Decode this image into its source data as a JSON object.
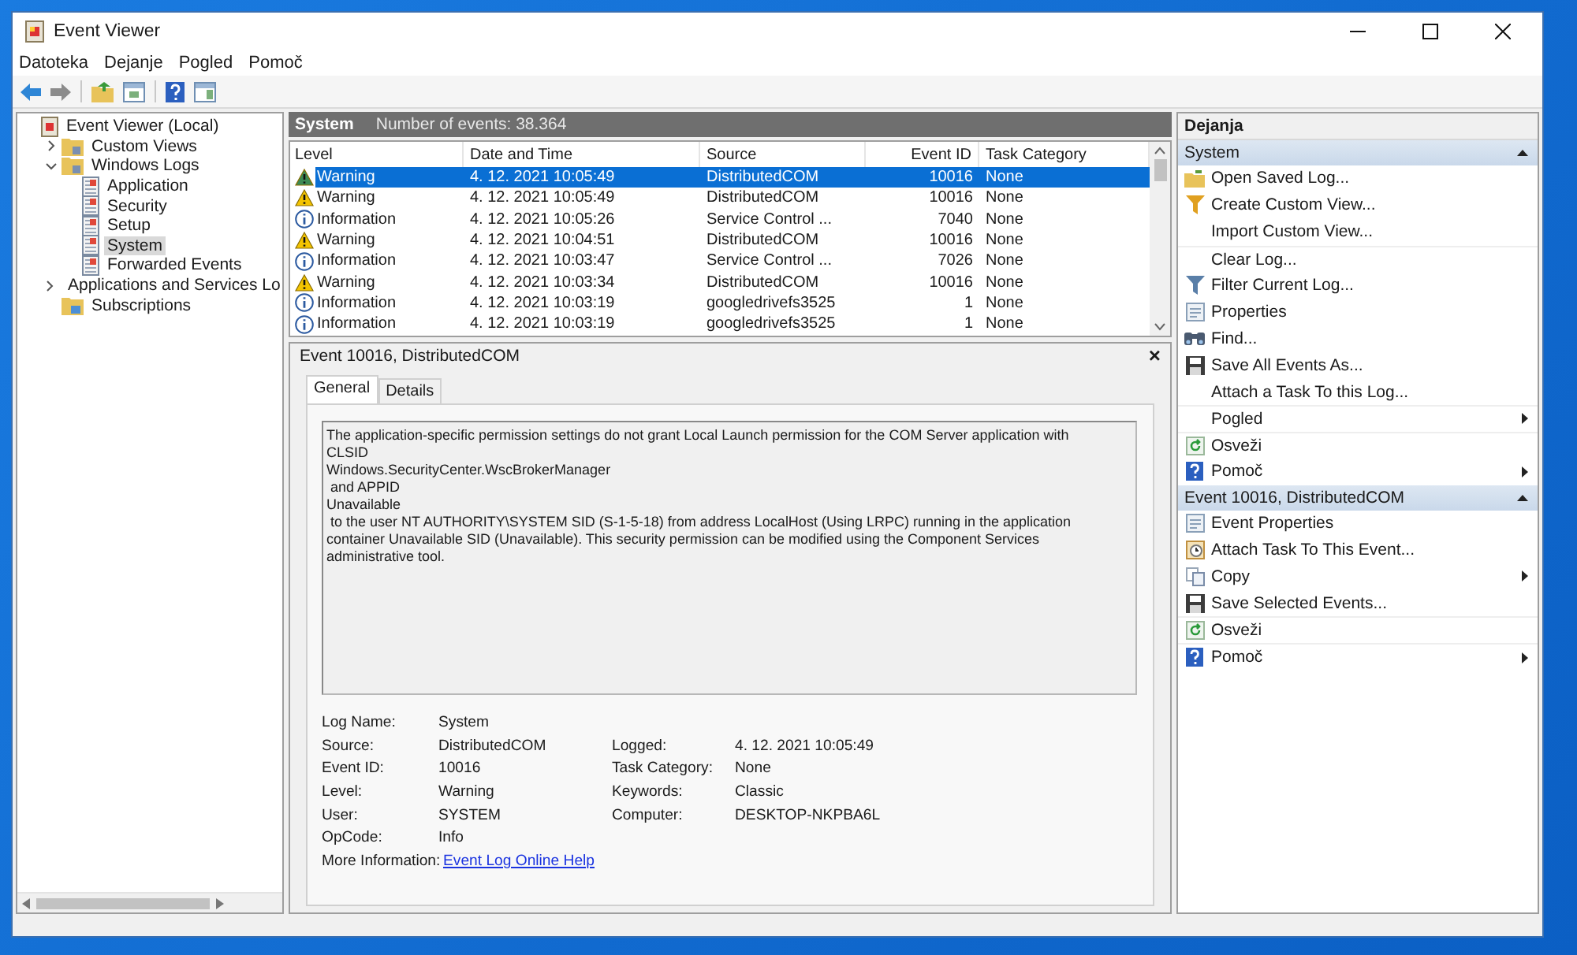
{
  "window": {
    "title": "Event Viewer"
  },
  "menu": [
    "Datoteka",
    "Dejanje",
    "Pogled",
    "Pomoč"
  ],
  "tree": [
    {
      "label": "Event Viewer (Local)",
      "selected": false,
      "children": [
        {
          "label": "Custom Views",
          "expanded": false,
          "selected": false
        },
        {
          "label": "Windows Logs",
          "expanded": true,
          "selected": false,
          "children": [
            {
              "label": "Application",
              "selected": false
            },
            {
              "label": "Security",
              "selected": false
            },
            {
              "label": "Setup",
              "selected": false
            },
            {
              "label": "System",
              "selected": true
            },
            {
              "label": "Forwarded Events",
              "selected": false
            }
          ]
        },
        {
          "label": "Applications and Services Lo",
          "expanded": false,
          "selected": false
        },
        {
          "label": "Subscriptions",
          "selected": false
        }
      ]
    }
  ],
  "log": {
    "name": "System",
    "event_count": "Number of events: 38.364",
    "table": {
      "columns": [
        "Level",
        "Date and Time",
        "Source",
        "Event ID",
        "Task Category"
      ],
      "rows": [
        {
          "kind": "warning",
          "level": "Warning",
          "date": "4. 12. 2021 10:05:49",
          "source": "DistributedCOM",
          "event_id": "10016",
          "task_category": "None",
          "selected": true
        },
        {
          "kind": "warning",
          "level": "Warning",
          "date": "4. 12. 2021 10:05:49",
          "source": "DistributedCOM",
          "event_id": "10016",
          "task_category": "None",
          "selected": false
        },
        {
          "kind": "information",
          "level": "Information",
          "date": "4. 12. 2021 10:05:26",
          "source": "Service Control ...",
          "event_id": "7040",
          "task_category": "None",
          "selected": false
        },
        {
          "kind": "warning",
          "level": "Warning",
          "date": "4. 12. 2021 10:04:51",
          "source": "DistributedCOM",
          "event_id": "10016",
          "task_category": "None",
          "selected": false
        },
        {
          "kind": "information",
          "level": "Information",
          "date": "4. 12. 2021 10:03:47",
          "source": "Service Control ...",
          "event_id": "7026",
          "task_category": "None",
          "selected": false
        },
        {
          "kind": "warning",
          "level": "Warning",
          "date": "4. 12. 2021 10:03:34",
          "source": "DistributedCOM",
          "event_id": "10016",
          "task_category": "None",
          "selected": false
        },
        {
          "kind": "information",
          "level": "Information",
          "date": "4. 12. 2021 10:03:19",
          "source": "googledrivefs3525",
          "event_id": "1",
          "task_category": "None",
          "selected": false
        },
        {
          "kind": "information",
          "level": "Information",
          "date": "4. 12. 2021 10:03:19",
          "source": "googledrivefs3525",
          "event_id": "1",
          "task_category": "None",
          "selected": false
        }
      ]
    }
  },
  "detail": {
    "title": "Event 10016, DistributedCOM",
    "close": "×",
    "tabs": [
      {
        "label": "General",
        "selected": true
      },
      {
        "label": "Details",
        "selected": false
      }
    ],
    "message": [
      "The application-specific permission settings do not grant Local Launch permission for the COM Server application with",
      "CLSID",
      "Windows.SecurityCenter.WscBrokerManager",
      " and APPID",
      "Unavailable",
      " to the user NT AUTHORITY\\SYSTEM SID (S-1-5-18) from address LocalHost (Using LRPC) running in the application",
      "container Unavailable SID (Unavailable). This security permission can be modified using the Component Services",
      "administrative tool."
    ],
    "properties": [
      {
        "left": {
          "label": "Log Name:",
          "value": "System"
        }
      },
      {
        "left": {
          "label": "Source:",
          "value": "DistributedCOM"
        },
        "right": {
          "label": "Logged:",
          "value": "4. 12. 2021 10:05:49"
        }
      },
      {
        "left": {
          "label": "Event ID:",
          "value": "10016"
        },
        "right": {
          "label": "Task Category:",
          "value": "None"
        }
      },
      {
        "left": {
          "label": "Level:",
          "value": "Warning"
        },
        "right": {
          "label": "Keywords:",
          "value": "Classic"
        }
      },
      {
        "left": {
          "label": "User:",
          "value": "SYSTEM"
        },
        "right": {
          "label": "Computer:",
          "value": "DESKTOP-NKPBA6L"
        }
      },
      {
        "left": {
          "label": "OpCode:",
          "value": "Info"
        }
      }
    ],
    "more_info": {
      "label": "More Information:",
      "link": "Event Log Online Help"
    }
  },
  "actions": {
    "title": "Dejanja",
    "sections": [
      {
        "title": "System",
        "items": [
          {
            "label": "Open Saved Log...",
            "submenu": false
          },
          {
            "label": "Create Custom View...",
            "submenu": false
          },
          {
            "label": "Import Custom View...",
            "submenu": false
          },
          {
            "label": "Clear Log...",
            "submenu": false
          },
          {
            "label": "Filter Current Log...",
            "submenu": false
          },
          {
            "label": "Properties",
            "submenu": false
          },
          {
            "label": "Find...",
            "submenu": false
          },
          {
            "label": "Save All Events As...",
            "submenu": false
          },
          {
            "label": "Attach a Task To this Log...",
            "submenu": false
          },
          {
            "label": "Pogled",
            "submenu": true
          },
          {
            "label": "Osveži",
            "submenu": false
          },
          {
            "label": "Pomoč",
            "submenu": true
          }
        ]
      },
      {
        "title": "Event 10016, DistributedCOM",
        "items": [
          {
            "label": "Event Properties",
            "submenu": false
          },
          {
            "label": "Attach Task To This Event...",
            "submenu": false
          },
          {
            "label": "Copy",
            "submenu": true
          },
          {
            "label": "Save Selected Events...",
            "submenu": false
          },
          {
            "label": "Osveži",
            "submenu": false
          },
          {
            "label": "Pomoč",
            "submenu": true
          }
        ]
      }
    ]
  }
}
